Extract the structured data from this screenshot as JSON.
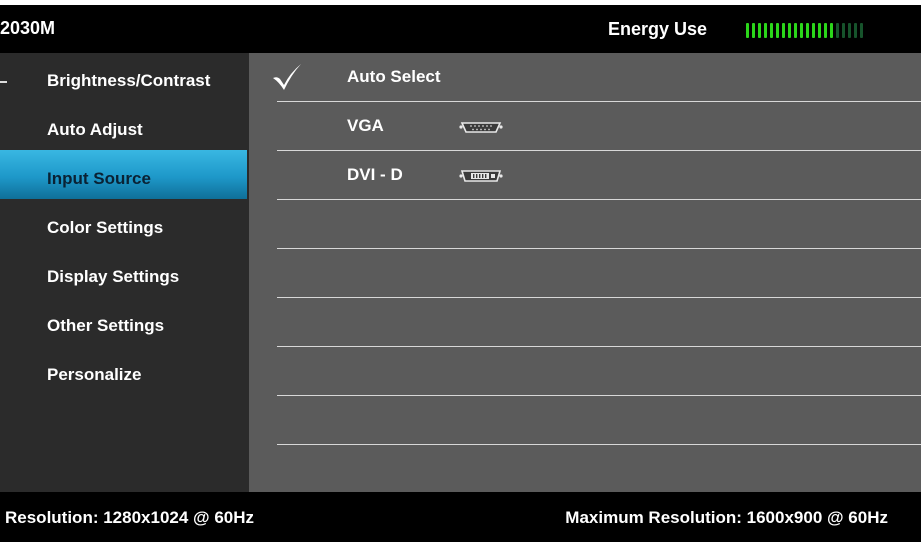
{
  "header": {
    "model": "2030M",
    "energy_label": "Energy Use",
    "energy_level": {
      "lit_segments": 15,
      "total_segments": 20
    }
  },
  "menu": {
    "items": [
      {
        "label": "Brightness/Contrast",
        "selected": false
      },
      {
        "label": "Auto Adjust",
        "selected": false
      },
      {
        "label": "Input Source",
        "selected": true
      },
      {
        "label": "Color Settings",
        "selected": false
      },
      {
        "label": "Display Settings",
        "selected": false
      },
      {
        "label": "Other Settings",
        "selected": false
      },
      {
        "label": "Personalize",
        "selected": false
      }
    ]
  },
  "input_source": {
    "options": [
      {
        "label": "Auto Select",
        "checked": true,
        "icon": ""
      },
      {
        "label": "VGA",
        "checked": false,
        "icon": "vga-port-icon"
      },
      {
        "label": "DVI - D",
        "checked": false,
        "icon": "dvi-port-icon"
      }
    ]
  },
  "footer": {
    "resolution": "Resolution: 1280x1024 @ 60Hz",
    "max_resolution": "Maximum Resolution: 1600x900 @ 60Hz"
  },
  "colors": {
    "highlight": "#1e98c9",
    "panel": "#5b5b5b",
    "sidebar": "#2b2b2b",
    "meter_on": "#2bd61a"
  }
}
